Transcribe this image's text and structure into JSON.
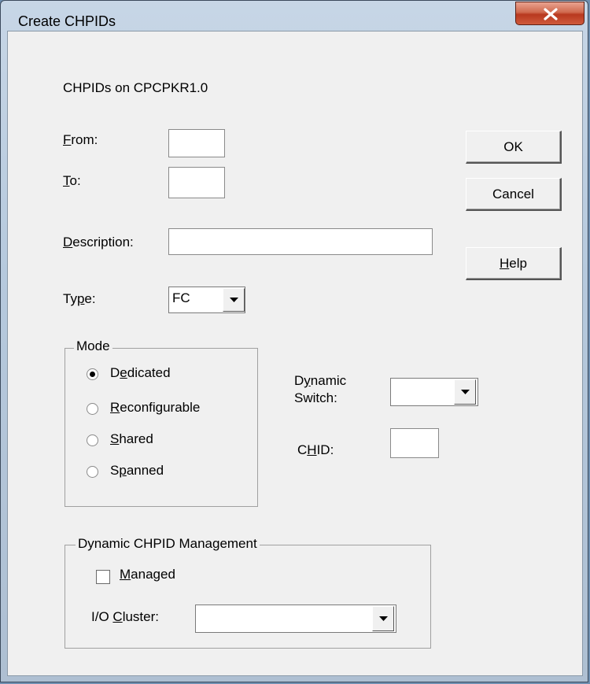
{
  "window": {
    "title": "Create CHPIDs"
  },
  "header": {
    "caption": "CHPIDs on CPCPKR1.0"
  },
  "fields": {
    "from_label": "From:",
    "to_label": "To:",
    "description_label": "Description:",
    "type_label": "Type:",
    "type_value": "FC",
    "from_value": "",
    "to_value": "",
    "description_value": ""
  },
  "buttons": {
    "ok": "OK",
    "cancel": "Cancel",
    "help": "Help"
  },
  "mode": {
    "title": "Mode",
    "selected": "Dedicated",
    "options": [
      "Dedicated",
      "Reconfigurable",
      "Shared",
      "Spanned"
    ]
  },
  "dynamic_switch": {
    "label_line1": "Dynamic",
    "label_line2": "Switch:",
    "value": ""
  },
  "chid": {
    "label": "CHID:",
    "value": ""
  },
  "dcm": {
    "title": "Dynamic CHPID Management",
    "managed_label": "Managed",
    "managed_checked": false,
    "io_cluster_label": "I/O Cluster:",
    "io_cluster_value": ""
  }
}
